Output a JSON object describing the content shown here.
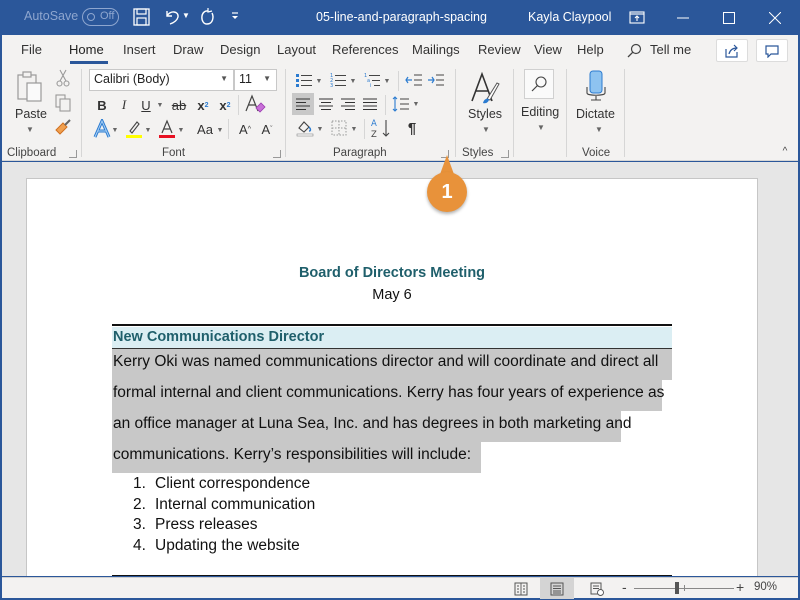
{
  "titlebar": {
    "autosave_label": "AutoSave",
    "autosave_state": "Off",
    "document_title": "05-line-and-paragraph-spacing",
    "user_name": "Kayla Claypool",
    "icons": [
      "save-icon",
      "undo-icon",
      "redo-icon",
      "customize-qat-icon",
      "ribbon-display-icon",
      "minimize-icon",
      "maximize-icon",
      "close-icon"
    ]
  },
  "tabs": {
    "items": [
      {
        "label": "File"
      },
      {
        "label": "Home",
        "active": true
      },
      {
        "label": "Insert"
      },
      {
        "label": "Draw"
      },
      {
        "label": "Design"
      },
      {
        "label": "Layout"
      },
      {
        "label": "References"
      },
      {
        "label": "Mailings"
      },
      {
        "label": "Review"
      },
      {
        "label": "View"
      },
      {
        "label": "Help"
      }
    ],
    "tell_me": "Tell me"
  },
  "ribbon": {
    "clipboard": {
      "label": "Clipboard",
      "paste_label": "Paste"
    },
    "font": {
      "label": "Font",
      "font_name": "Calibri (Body)",
      "font_size": "11",
      "bold": "B",
      "italic": "I",
      "underline": "U",
      "strikethrough": "ab",
      "subscript": "x",
      "superscript": "x",
      "change_case": "Aa",
      "font_color_hex": "#e81123",
      "highlight_color_hex": "#ffff00"
    },
    "paragraph": {
      "label": "Paragraph",
      "sort_label": "AZ",
      "show_marks": "¶"
    },
    "styles": {
      "label": "Styles",
      "button_label": "Styles"
    },
    "editing": {
      "button_label": "Editing"
    },
    "voice": {
      "label": "Voice",
      "button_label": "Dictate"
    }
  },
  "callout": {
    "number": "1",
    "color": "#e8923a"
  },
  "document": {
    "heading": "Board of Directors Meeting",
    "date": "May 6",
    "section_heading": "New Communications Director",
    "paragraph_lines": [
      "Kerry Oki was named communications director and will coordinate and direct all",
      "formal internal and client communications. Kerry has four years of experience as",
      "an office manager at Luna Sea, Inc. and has degrees in both marketing and",
      "communications. Kerry’s responsibilities will include:"
    ],
    "list": [
      {
        "num": "1.",
        "text": "Client correspondence"
      },
      {
        "num": "2.",
        "text": "Internal communication"
      },
      {
        "num": "3.",
        "text": "Press releases"
      },
      {
        "num": "4.",
        "text": "Updating the website"
      }
    ]
  },
  "statusbar": {
    "zoom_minus": "-",
    "zoom_plus": "+",
    "zoom_level": "90%",
    "zoom_percent": 90,
    "active_view": "print-layout"
  }
}
